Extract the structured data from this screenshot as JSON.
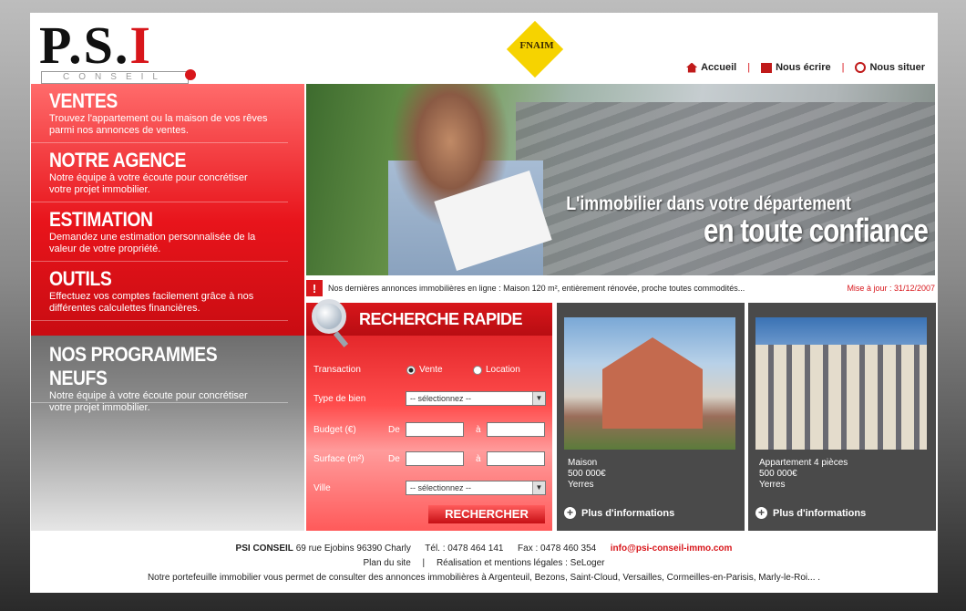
{
  "header": {
    "logo_text": "P.S.I",
    "logo_sub": "CONSEIL",
    "fnaim": "FNAIM",
    "nav": [
      {
        "label": "Accueil",
        "icon": "home-icon"
      },
      {
        "label": "Nous écrire",
        "icon": "mail-icon"
      },
      {
        "label": "Nous situer",
        "icon": "search-icon"
      }
    ]
  },
  "menu": [
    {
      "title": "VENTES",
      "desc": "Trouvez l'appartement ou la maison de vos rêves parmi nos annonces de ventes."
    },
    {
      "title": "NOTRE AGENCE",
      "desc": "Notre équipe à votre écoute pour concrétiser votre projet immobilier."
    },
    {
      "title": "ESTIMATION",
      "desc": "Demandez une estimation personnalisée de la valeur de votre propriété."
    },
    {
      "title": "OUTILS",
      "desc": "Effectuez vos comptes facilement grâce à nos différentes calculettes financières."
    }
  ],
  "programmes": {
    "title": "NOS PROGRAMMES NEUFS",
    "desc": "Notre équipe à votre écoute pour concrétiser votre projet immobilier."
  },
  "banner": {
    "line1": "L'immobilier dans votre département",
    "line2": "en toute confiance"
  },
  "ticker": {
    "alert": "!",
    "message": "Nos dernières annonces immobilières en ligne : Maison 120 m², entièrement rénovée, proche toutes commodités...",
    "date": "Mise à jour : 31/12/2007"
  },
  "search": {
    "title": "RECHERCHE RAPIDE",
    "transaction_label": "Transaction",
    "opt_vente": "Vente",
    "opt_location": "Location",
    "type_label": "Type de bien",
    "type_value": "-- sélectionnez --",
    "budget_label": "Budget (€)",
    "surface_label": "Surface (m²)",
    "de": "De",
    "a": "à",
    "ville_label": "Ville",
    "ville_value": "-- sélectionnez --",
    "submit": "RECHERCHER"
  },
  "cards": [
    {
      "type": "Maison",
      "price": "500 000€",
      "city": "Yerres",
      "more": "Plus d'informations"
    },
    {
      "type": "Appartement 4 pièces",
      "price": "500 000€",
      "city": "Yerres",
      "more": "Plus d'informations"
    }
  ],
  "footer": {
    "company": "PSI CONSEIL",
    "address": "69 rue Ejobins 96390 Charly",
    "tel": "Tél. : 0478 464 141",
    "fax": "Fax : 0478 460 354",
    "email": "info@psi-conseil-immo.com",
    "plan": "Plan du site",
    "sep": "|",
    "legal": "Réalisation et mentions légales : SeLoger",
    "portfolio": "Notre portefeuille immobilier vous permet de consulter des annonces immobilières à Argenteuil, Bezons, Saint-Cloud, Versailles, Cormeilles-en-Parisis, Marly-le-Roi... ."
  },
  "colors": {
    "brand_red": "#d8161b",
    "card_gray": "#4a4a4a"
  }
}
